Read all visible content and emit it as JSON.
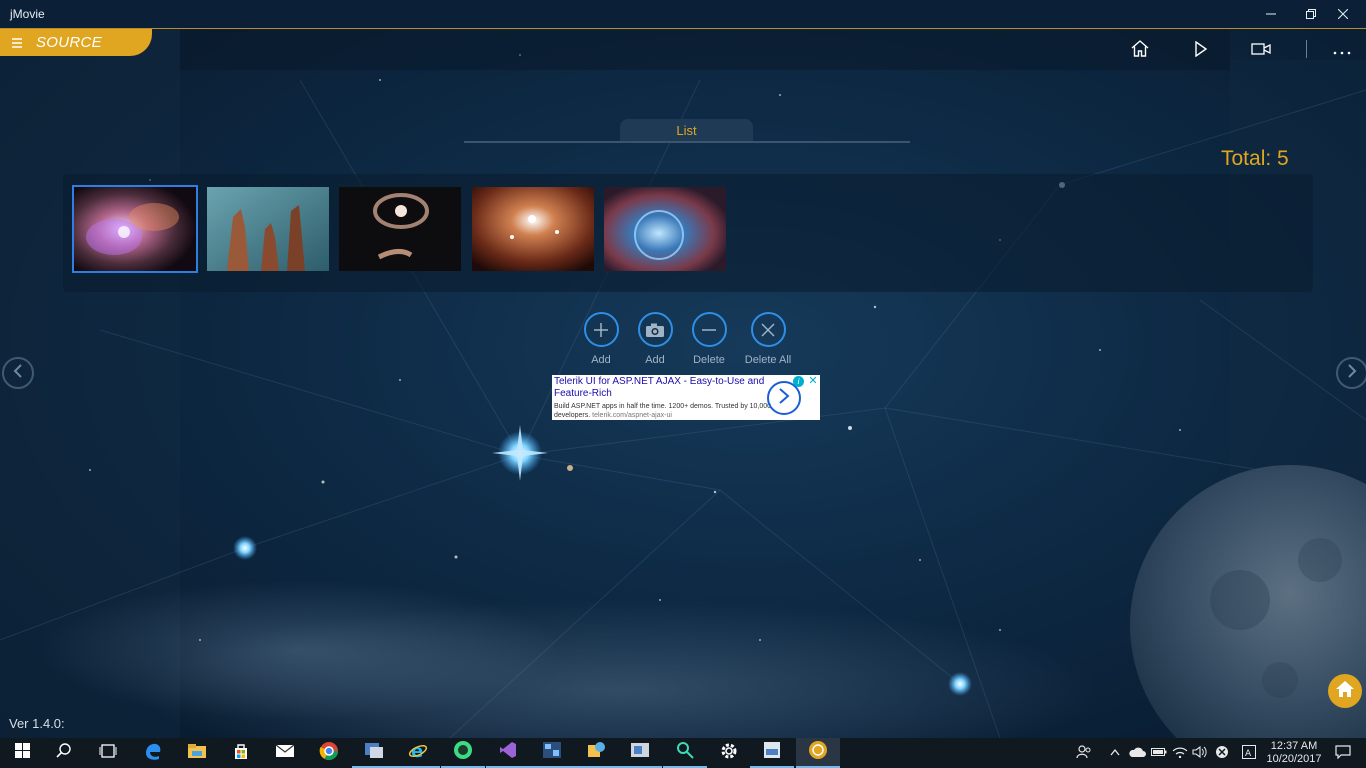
{
  "window": {
    "title": "jMovie",
    "controls": [
      "minimize-icon",
      "restore-icon",
      "close-icon"
    ]
  },
  "header": {
    "source_label": "SOURCE",
    "menu_icon": "hamburger-icon",
    "actions": [
      "home-icon",
      "play-icon",
      "video-camera-icon",
      "more-icon"
    ]
  },
  "list_tab": {
    "label": "List"
  },
  "total_label": "Total: 5",
  "thumbnails": [
    {
      "name": "nebula-cluster",
      "selected": true
    },
    {
      "name": "pillars-of-creation",
      "selected": false
    },
    {
      "name": "interacting-galaxies",
      "selected": false
    },
    {
      "name": "star-cluster-nebula",
      "selected": false
    },
    {
      "name": "bubble-nebula",
      "selected": false
    }
  ],
  "actions": [
    {
      "icon": "plus-icon",
      "label": "Add"
    },
    {
      "icon": "camera-add-icon",
      "label": "Add"
    },
    {
      "icon": "minus-icon",
      "label": "Delete"
    },
    {
      "icon": "x-icon",
      "label": "Delete All"
    }
  ],
  "ad": {
    "headline": "Telerik UI for ASP.NET AJAX - Easy-to-Use and Feature-Rich",
    "body": "Build ASP.NET apps in half the time. 1200+ demos. Trusted by 10,000 developers.",
    "url": "telerik.com/aspnet-ajax-ui",
    "info_glyph": "i",
    "close_glyph": "✕"
  },
  "version": "Ver 1.4.0:",
  "taskbar": {
    "apps": [
      "windows-start-icon",
      "search-icon",
      "task-view-icon",
      "edge-icon",
      "file-explorer-icon",
      "store-icon",
      "mail-icon",
      "chrome-icon",
      "app-icon",
      "internet-explorer-icon",
      "android-studio-icon",
      "visual-studio-icon",
      "app-icon",
      "app-icon",
      "app-icon",
      "app-icon",
      "settings-icon",
      "app-icon",
      "jmovie-icon"
    ],
    "clock_time": "12:37 AM",
    "clock_date": "10/20/2017"
  },
  "colors": {
    "accent": "#e0a622",
    "blue": "#2f8fe6",
    "background": "#0e2a45"
  }
}
